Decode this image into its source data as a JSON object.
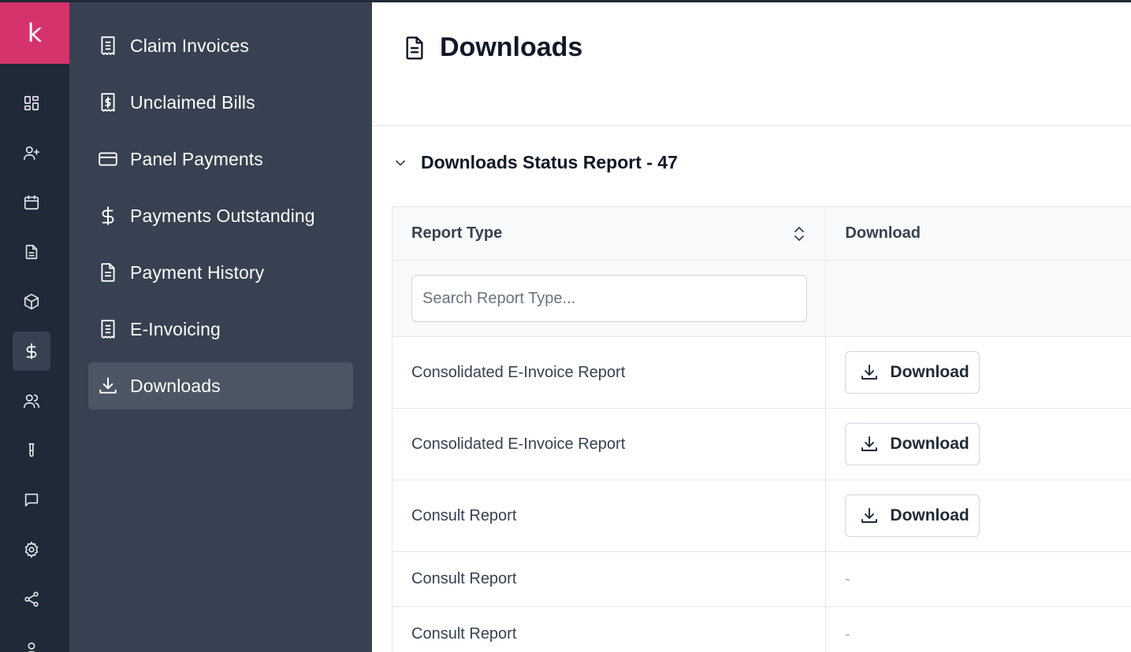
{
  "app": {
    "logo_letter": "k"
  },
  "rail": {
    "items": [
      "dashboard",
      "add-user",
      "calendar",
      "document",
      "inventory",
      "billing",
      "patients",
      "lab",
      "messages",
      "settings",
      "share",
      "profile"
    ],
    "active": "billing"
  },
  "sidebar": {
    "items": [
      {
        "label": "Claim Invoices",
        "icon": "receipt-icon"
      },
      {
        "label": "Unclaimed Bills",
        "icon": "receipt-dollar-icon"
      },
      {
        "label": "Panel Payments",
        "icon": "credit-card-icon"
      },
      {
        "label": "Payments Outstanding",
        "icon": "dollar-icon"
      },
      {
        "label": "Payment History",
        "icon": "document-icon"
      },
      {
        "label": "E-Invoicing",
        "icon": "receipt-icon"
      },
      {
        "label": "Downloads",
        "icon": "download-icon",
        "active": true
      }
    ]
  },
  "page": {
    "title": "Downloads"
  },
  "section": {
    "title": "Downloads Status Report - 47",
    "expanded": true
  },
  "table": {
    "columns": [
      "Report Type",
      "Download"
    ],
    "search_placeholder": "Search Report Type...",
    "rows": [
      {
        "report_type": "Consolidated E-Invoice Report",
        "download": "Download"
      },
      {
        "report_type": "Consolidated E-Invoice Report",
        "download": "Download"
      },
      {
        "report_type": "Consult Report",
        "download": "Download"
      },
      {
        "report_type": "Consult Report",
        "download": "-"
      },
      {
        "report_type": "Consult Report",
        "download": "-"
      }
    ]
  },
  "colors": {
    "brand": "#d6336c",
    "rail_bg": "#1f2937",
    "sidebar_bg": "#374151",
    "sidebar_active": "#4b5563"
  }
}
